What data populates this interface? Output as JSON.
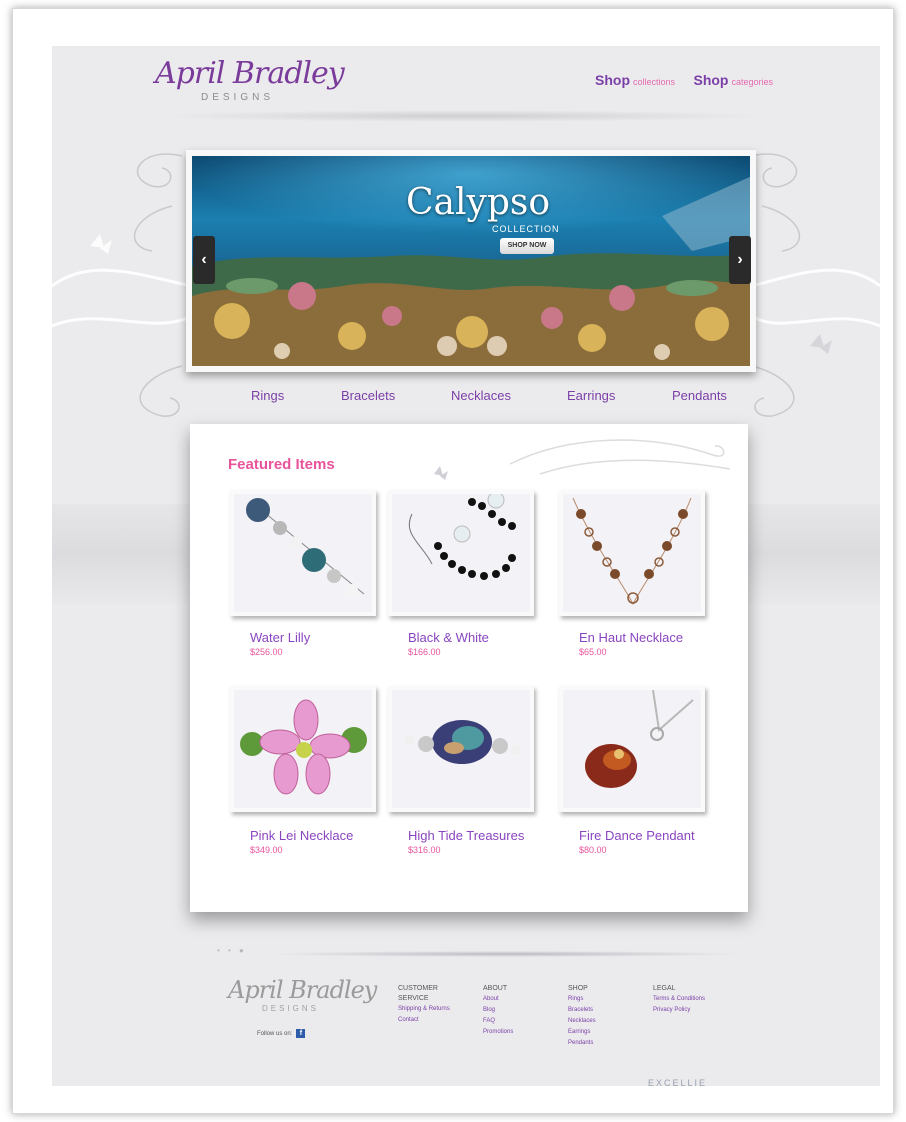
{
  "logo": {
    "script": "April Bradley",
    "sub": "DESIGNS"
  },
  "header": {
    "shop_links": [
      {
        "main": "Shop",
        "sub": "collections"
      },
      {
        "main": "Shop",
        "sub": "categories"
      }
    ]
  },
  "hero": {
    "title": "Calypso",
    "subtitle": "COLLECTION",
    "button": "SHOP NOW",
    "prev_icon": "chevron-left-icon",
    "next_icon": "chevron-right-icon",
    "prev_glyph": "‹",
    "next_glyph": "›"
  },
  "categories": [
    "Rings",
    "Bracelets",
    "Necklaces",
    "Earrings",
    "Pendants"
  ],
  "featured": {
    "title": "Featured Items",
    "products": [
      {
        "name": "Water Lilly",
        "price": "$256.00"
      },
      {
        "name": "Black & White",
        "price": "$166.00"
      },
      {
        "name": "En Haut Necklace",
        "price": "$65.00"
      },
      {
        "name": "Pink Lei Necklace",
        "price": "$349.00"
      },
      {
        "name": "High Tide Treasures",
        "price": "$316.00"
      },
      {
        "name": "Fire Dance Pendant",
        "price": "$80.00"
      }
    ]
  },
  "footer": {
    "logo_script": "April Bradley",
    "logo_sub": "DESIGNS",
    "follow_text": "Follow us on:",
    "facebook_glyph": "f",
    "columns": [
      {
        "heading_1": "CUSTOMER",
        "heading_2": "SERVICE",
        "links": [
          "Shipping & Returns",
          "Contact"
        ]
      },
      {
        "heading_1": "ABOUT",
        "heading_2": "",
        "links": [
          "About",
          "Blog",
          "FAQ",
          "Promotions"
        ]
      },
      {
        "heading_1": "SHOP",
        "heading_2": "",
        "links": [
          "Rings",
          "Bracelets",
          "Necklaces",
          "Earrings",
          "Pendants"
        ]
      },
      {
        "heading_1": "LEGAL",
        "heading_2": "",
        "links": [
          "Terms & Conditions",
          "Privacy Policy"
        ]
      }
    ],
    "cutoff_text": "EXCELLIE"
  },
  "colors": {
    "brand_purple": "#7b3fa8",
    "accent_pink": "#e8549c",
    "page_bg": "#ebebed"
  }
}
